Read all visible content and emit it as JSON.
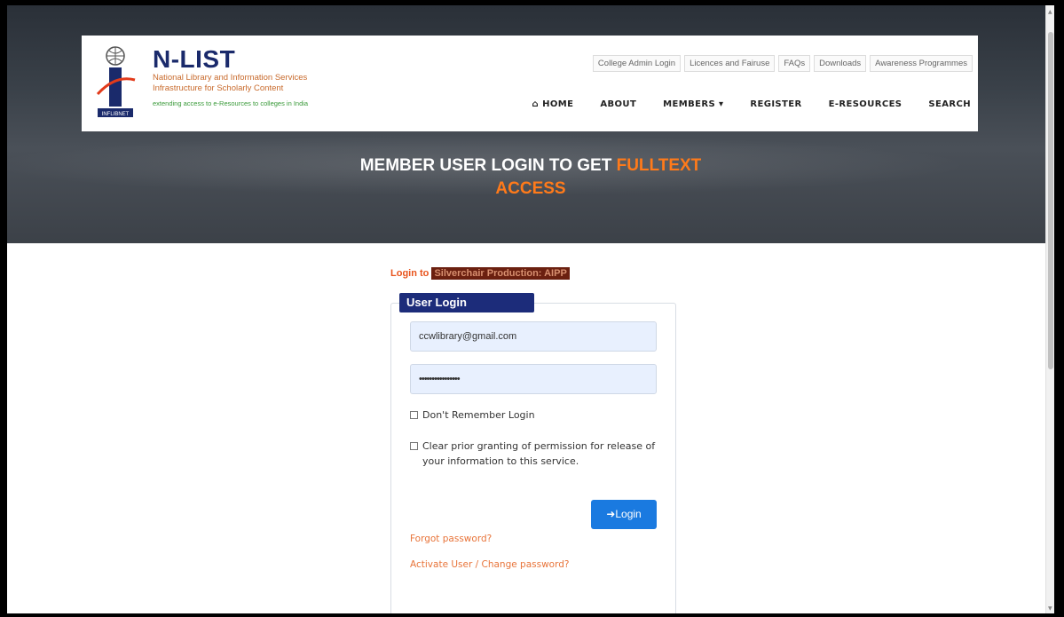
{
  "brand": {
    "name": "N-LIST",
    "line1": "National Library and Information Services",
    "line2": "Infrastructure for Scholarly Content",
    "tagline": "extending access to e-Resources to colleges in India",
    "logo_text": "INFLIBNET"
  },
  "util_links": [
    "College Admin Login",
    "Licences and Fairuse",
    "FAQs",
    "Downloads",
    "Awareness Programmes"
  ],
  "nav": {
    "home": "HOME",
    "about": "ABOUT",
    "members": "MEMBERS ▾",
    "register": "REGISTER",
    "eresources": "E-RESOURCES",
    "search": "SEARCH"
  },
  "hero": {
    "line_white": "MEMBER USER LOGIN TO GET",
    "accent_part1": "FULLTEXT",
    "accent_part2": "ACCESS"
  },
  "login": {
    "login_to_label": "Login to",
    "service_name": "Silverchair Production: AIPP",
    "card_title": "User Login",
    "email_value": "ccwlibrary@gmail.com",
    "password_value": "••••••••••••••••",
    "dont_remember": "Don't Remember Login",
    "clear_prior": "Clear prior granting of permission for release of your information to this service.",
    "login_button": "Login",
    "forgot": "Forgot password?",
    "activate": "Activate User / Change password?"
  },
  "colors": {
    "brand_navy": "#1a2a6b",
    "accent_orange": "#ff7a1a",
    "button_blue": "#1a7ae0",
    "link_orange": "#e8743a"
  }
}
